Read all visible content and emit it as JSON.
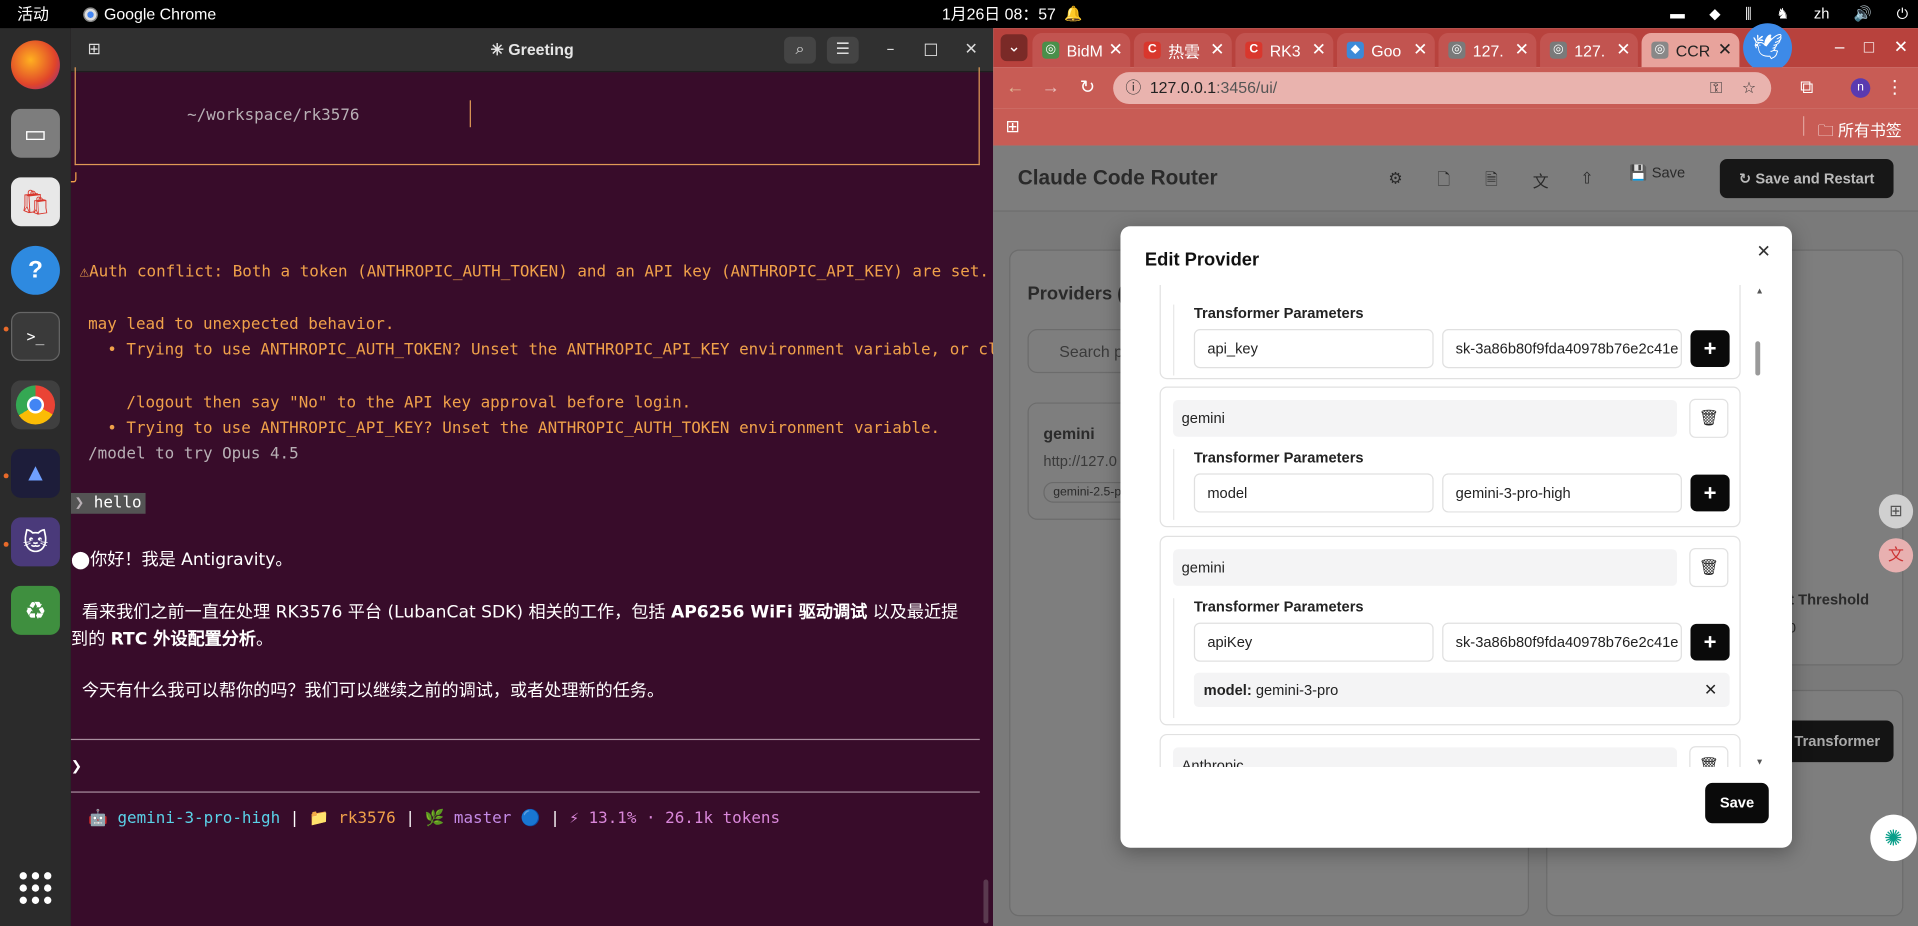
{
  "topbar": {
    "activities": "活动",
    "app_name": "Google Chrome",
    "datetime": "1月26日  08：57",
    "lang": "zh"
  },
  "dock": {
    "items": [
      "firefox-icon",
      "files-icon",
      "app-center-icon",
      "help-icon",
      "terminal-icon",
      "chrome-icon",
      "antigravity-icon",
      "cat-app-icon",
      "trash-icon"
    ]
  },
  "terminal": {
    "title": "✳ Greeting",
    "cwd": "~/workspace/rk3576",
    "box_corner": "╯",
    "warn1": "⚠Auth conflict: Both a token (ANTHROPIC_AUTH_TOKEN) and an API key (ANTHROPIC_API_KEY) are set. This",
    "warn2": "may lead to unexpected behavior.",
    "warn3": "  • Trying to use ANTHROPIC_AUTH_TOKEN? Unset the ANTHROPIC_API_KEY environment variable, or claude",
    "warn4": "    /logout then say \"No\" to the API key approval before login.",
    "warn5": "  • Trying to use ANTHROPIC_API_KEY? Unset the ANTHROPIC_AUTH_TOKEN environment variable.",
    "hint": "/model to try Opus 4.5",
    "prompt_marker": "❯",
    "user_input": "hello",
    "reply1": "⬤你好！我是 Antigravity。",
    "reply2_a": "  看来我们之前一直在处理 RK3576 平台 (LubanCat SDK) 相关的工作，包括 ",
    "reply2_b": "AP6256 WiFi 驱动调试",
    "reply2_c": " 以及最近提",
    "reply2_d": "到的 ",
    "reply2_e": "RTC 外设配置分析",
    "reply2_f": "。",
    "reply3": "  今天有什么我可以帮你的吗？我们可以继续之前的调试，或者处理新的任务。",
    "input_prompt": "❯",
    "status": {
      "model": "🤖 gemini-3-pro-high",
      "sep": " | ",
      "folder": "📁 rk3576",
      "branch": "🌿 master 🔵",
      "usage": "⚡ 13.1% · 26.1k tokens"
    }
  },
  "chrome": {
    "tabs": [
      {
        "label": "BidM",
        "fav": "◎",
        "fav_color": "#4a8f4a"
      },
      {
        "label": "热雲",
        "fav": "C",
        "fav_color": "#d9372d"
      },
      {
        "label": "RK3",
        "fav": "C",
        "fav_color": "#d9372d"
      },
      {
        "label": "Goo",
        "fav": "◆",
        "fav_color": "#3c8ad8"
      },
      {
        "label": "127.",
        "fav": "◎",
        "fav_color": "#7a7a7a"
      },
      {
        "label": "127.",
        "fav": "◎",
        "fav_color": "#7a7a7a"
      },
      {
        "label": "CCR",
        "fav": "◎",
        "fav_color": "#888888"
      }
    ],
    "url_host": "127.0.0.1",
    "url_rest": ":3456/ui/",
    "bookmarks_label": "所有书签",
    "accent": "#c85c55"
  },
  "ccr": {
    "title": "Claude Code Router",
    "save_label": "Save",
    "save_restart_label": "Save and Restart",
    "providers_label": "Providers (",
    "search_placeholder": "Search pr",
    "provider_name": "gemini",
    "provider_url": "http://127.0",
    "provider_model_chip": "gemini-2.5-p",
    "threshold_label": "xt Threshold",
    "threshold_value": "00",
    "transformer_button": "Transformer"
  },
  "modal": {
    "title": "Edit Provider",
    "save_label": "Save",
    "tp_label": "Transformer Parameters",
    "cards": [
      {
        "key": "api_key",
        "value": "sk-3a86b80f9fda40978b76e2c41e"
      },
      {
        "name": "gemini",
        "key": "model",
        "value": "gemini-3-pro-high"
      },
      {
        "name": "gemini",
        "key": "apiKey",
        "value": "sk-3a86b80f9fda40978b76e2c41e",
        "model_key": "model:",
        "model_value": " gemini-3-pro"
      },
      {
        "name": "Anthropic"
      }
    ]
  }
}
